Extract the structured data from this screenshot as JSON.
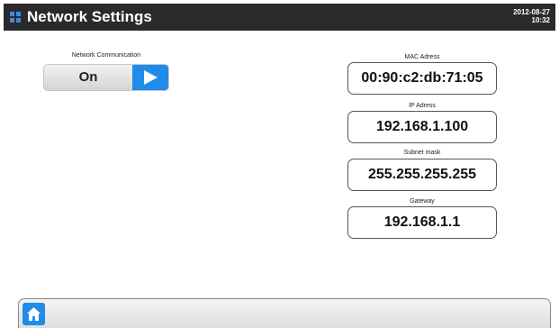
{
  "header": {
    "title": "Network Settings",
    "date": "2012-08-27",
    "time": "10:32",
    "icon": "grid-icon"
  },
  "network_communication": {
    "label": "Network Communication",
    "value": "On",
    "toggle_icon": "play-arrow-icon"
  },
  "fields": {
    "mac": {
      "label": "MAC Adress",
      "value": "00:90:c2:db:71:05"
    },
    "ip": {
      "label": "IP Adress",
      "value": "192.168.1.100"
    },
    "subnet": {
      "label": "Subnet mask",
      "value": "255.255.255.255"
    },
    "gateway": {
      "label": "Gateway",
      "value": "192.168.1.1"
    }
  },
  "footer": {
    "home_icon": "home-icon"
  },
  "colors": {
    "header_bg": "#2a2a2a",
    "accent": "#1e8ce8"
  }
}
